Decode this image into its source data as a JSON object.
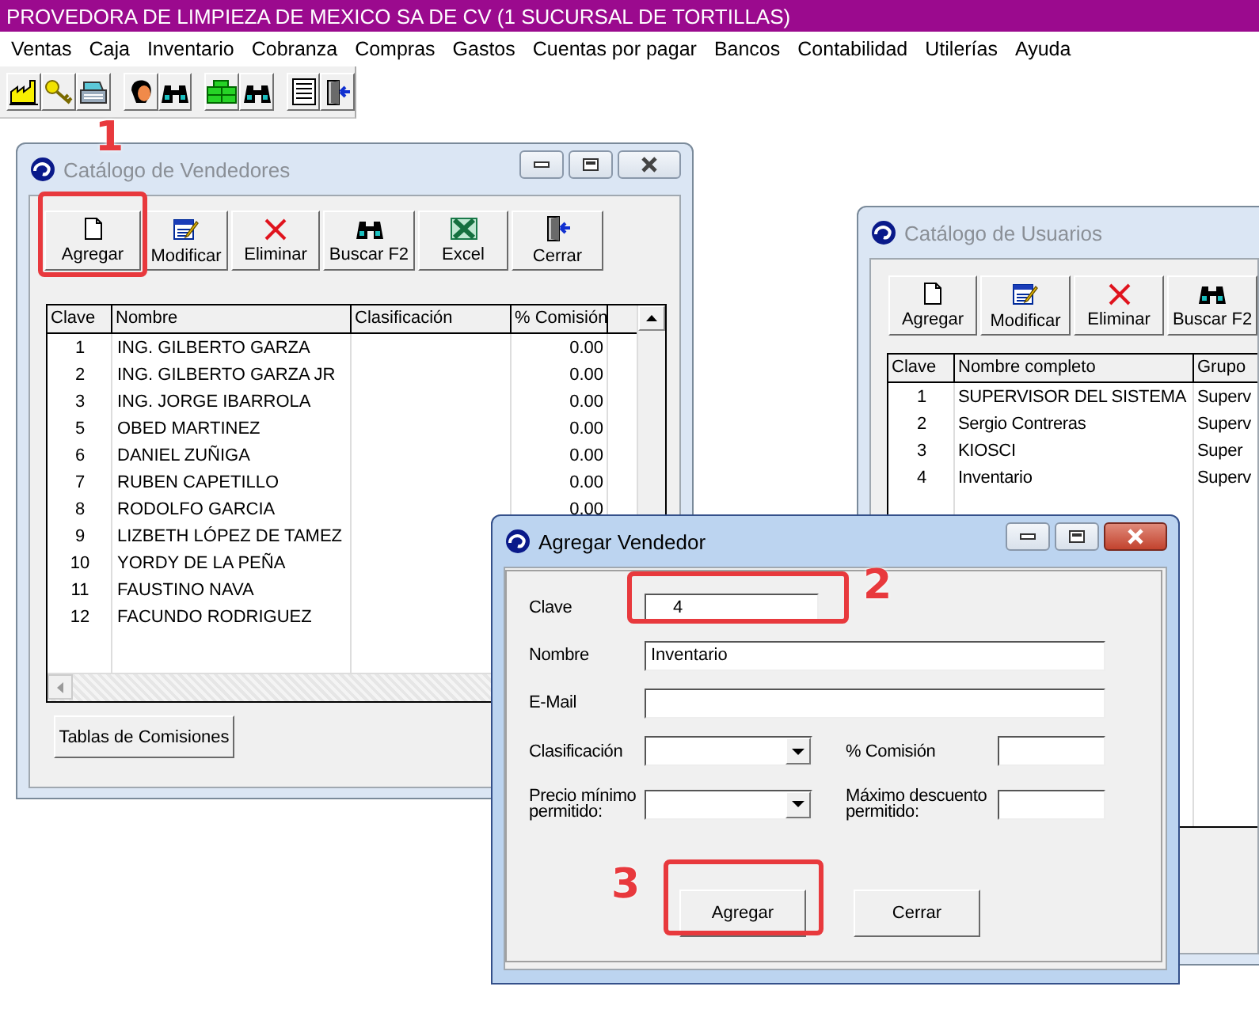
{
  "app_title": "PROVEDORA DE LIMPIEZA DE MEXICO SA DE CV  (1 SUCURSAL DE TORTILLAS)",
  "menu": [
    "Ventas",
    "Caja",
    "Inventario",
    "Cobranza",
    "Compras",
    "Gastos",
    "Cuentas por pagar",
    "Bancos",
    "Contabilidad",
    "Utilerías",
    "Ayuda"
  ],
  "vendedores": {
    "title": "Catálogo de Vendedores",
    "active": false,
    "buttons": [
      "Agregar",
      "Modificar",
      "Eliminar",
      "Buscar F2",
      "Excel",
      "Cerrar"
    ],
    "columns": [
      "Clave",
      "Nombre",
      "Clasificación",
      "% Comisión"
    ],
    "rows": [
      {
        "clave": "1",
        "nombre": "ING. GILBERTO GARZA",
        "comision": "0.00"
      },
      {
        "clave": "2",
        "nombre": "ING. GILBERTO GARZA JR",
        "comision": "0.00"
      },
      {
        "clave": "3",
        "nombre": "ING. JORGE IBARROLA",
        "comision": "0.00"
      },
      {
        "clave": "5",
        "nombre": "OBED MARTINEZ",
        "comision": "0.00"
      },
      {
        "clave": "6",
        "nombre": "DANIEL ZUÑIGA",
        "comision": "0.00"
      },
      {
        "clave": "7",
        "nombre": "RUBEN CAPETILLO",
        "comision": "0.00"
      },
      {
        "clave": "8",
        "nombre": "RODOLFO GARCIA",
        "comision": "0.00"
      },
      {
        "clave": "9",
        "nombre": "LIZBETH LÓPEZ DE TAMEZ"
      },
      {
        "clave": "10",
        "nombre": "YORDY DE LA PEÑA"
      },
      {
        "clave": "11",
        "nombre": "FAUSTINO NAVA"
      },
      {
        "clave": "12",
        "nombre": "FACUNDO RODRIGUEZ"
      }
    ],
    "footer_button": "Tablas de Comisiones"
  },
  "usuarios": {
    "title": "Catálogo de Usuarios",
    "active": false,
    "buttons": [
      "Agregar",
      "Modificar",
      "Eliminar",
      "Buscar F2"
    ],
    "columns": [
      "Clave",
      "Nombre completo",
      "Grupo"
    ],
    "rows": [
      {
        "clave": "1",
        "nombre": "SUPERVISOR DEL SISTEMA",
        "grupo": "Superv"
      },
      {
        "clave": "2",
        "nombre": "Sergio Contreras",
        "grupo": "Superv"
      },
      {
        "clave": "3",
        "nombre": "KIOSCI",
        "grupo": "Super"
      },
      {
        "clave": "4",
        "nombre": "Inventario",
        "grupo": "Superv"
      }
    ]
  },
  "agregar": {
    "title": "Agregar Vendedor",
    "active": true,
    "fields": [
      {
        "label": "Clave",
        "kind": "text",
        "value": "4"
      },
      {
        "label": "Nombre",
        "kind": "text",
        "value": "Inventario"
      },
      {
        "label": "E-Mail",
        "kind": "text"
      },
      {
        "label": "Clasificación",
        "kind": "combo"
      },
      {
        "label": "% Comisión",
        "kind": "text"
      },
      {
        "label": "Precio mínimo permitido:",
        "kind": "combo"
      },
      {
        "label": "Máximo descuento permitido:",
        "kind": "text"
      }
    ],
    "buttons": [
      "Agregar",
      "Cerrar"
    ]
  },
  "annotations": [
    "1",
    "2",
    "3"
  ]
}
